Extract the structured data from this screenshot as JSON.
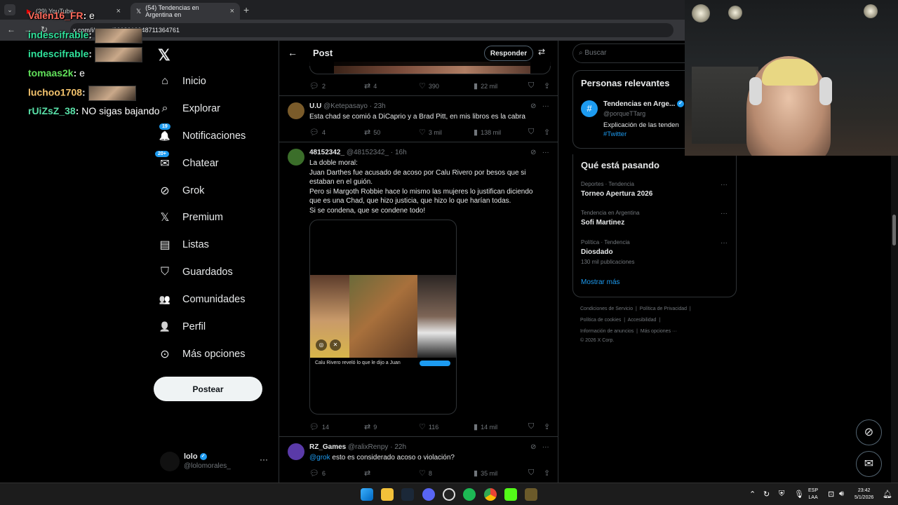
{
  "browser": {
    "tabs": [
      {
        "label": "(29) YouTube"
      },
      {
        "label": "(54) Tendencias en Argentina en"
      }
    ],
    "url": "x.com/i/status/2008010048711364761"
  },
  "chat": [
    {
      "user": "Valen16_FR",
      "color": "#ff6a5b",
      "msg": "e"
    },
    {
      "user": "indescifrable",
      "color": "#2fe09a",
      "msg": ""
    },
    {
      "user": "indescifrable",
      "color": "#2fe09a",
      "msg": ""
    },
    {
      "user": "tomaas2k",
      "color": "#61e05a",
      "msg": "e"
    },
    {
      "user": "luchoo1708",
      "color": "#f2c26c",
      "msg": ""
    },
    {
      "user": "rUiZsZ_38",
      "color": "#59e0a8",
      "msg": "NO sigas bajando"
    }
  ],
  "nav": {
    "items": [
      {
        "label": "Inicio",
        "icon": "⌂"
      },
      {
        "label": "Explorar",
        "icon": "⌕"
      },
      {
        "label": "Notificaciones",
        "icon": "🔔",
        "badge": "19"
      },
      {
        "label": "Chatear",
        "icon": "✉",
        "badge": "20+"
      },
      {
        "label": "Grok",
        "icon": "⊘"
      },
      {
        "label": "Premium",
        "icon": "𝕏"
      },
      {
        "label": "Listas",
        "icon": "▤"
      },
      {
        "label": "Guardados",
        "icon": "⛉"
      },
      {
        "label": "Comunidades",
        "icon": "👥"
      },
      {
        "label": "Perfil",
        "icon": "👤"
      },
      {
        "label": "Más opciones",
        "icon": "⊙"
      }
    ],
    "post_label": "Postear"
  },
  "account": {
    "name": "lolo",
    "handle": "@lolomorales_"
  },
  "header": {
    "title": "Post",
    "reply_label": "Responder"
  },
  "top_actions": {
    "replies": "2",
    "reposts": "4",
    "likes": "390",
    "views": "22 mil"
  },
  "tweets": [
    {
      "name": "U.U",
      "handle": "@Ketepasayo",
      "time": "23h",
      "avatar_color": "#7a5b2a",
      "text": "Esta chad se comió a DiCaprio y a Brad Pitt, en mis libros es la cabra",
      "actions": {
        "replies": "4",
        "reposts": "50",
        "likes": "3 mil",
        "views": "138 mil"
      }
    },
    {
      "name": "48152342_",
      "handle": "@48152342_",
      "time": "16h",
      "avatar_color": "#3b6e2a",
      "lines": [
        "La doble moral:",
        "Juan Darthes fue acusado de acoso por Calu Rivero por besos que si",
        "estaban en el guión.",
        "Pero si Margoth Robbie hace lo mismo las mujeres lo justifican diciendo",
        "que es una Chad, que hizo justicia, que hizo lo que harían todas.",
        "Si se condena, que se condene todo!"
      ],
      "video_caption": "Calu Rivero reveló lo que le dijo a Juan",
      "actions": {
        "replies": "14",
        "reposts": "9",
        "likes": "116",
        "views": "14 mil"
      }
    },
    {
      "name": "RZ_Games",
      "handle": "@ralixRenpy",
      "time": "22h",
      "avatar_color": "#5a3aa8",
      "mention": "@grok",
      "text": " esto es considerado acoso o violación?",
      "actions": {
        "replies": "6",
        "reposts": "",
        "likes": "8",
        "views": "35 mil"
      }
    }
  ],
  "search": {
    "placeholder": "Buscar"
  },
  "relevant": {
    "title": "Personas relevantes",
    "name": "Tendencias en Arge...",
    "handle": "@porqueTTarg",
    "bio": "Explicación de las tenden",
    "hashtag": "#Twitter"
  },
  "trends": {
    "title": "Qué está pasando",
    "items": [
      {
        "category": "Deportes · Tendencia",
        "name": "Torneo Apertura 2026",
        "count": ""
      },
      {
        "category": "Tendencia en Argentina",
        "name": "Sofi Martinez",
        "count": ""
      },
      {
        "category": "Política · Tendencia",
        "name": "Diosdado",
        "count": "130 mil publicaciones"
      }
    ],
    "show_more": "Mostrar más"
  },
  "footer": {
    "line1a": "Condiciones de Servicio",
    "line1b": "Política de Privacidad",
    "line2a": "Política de cookies",
    "line2b": "Accesibilidad",
    "line3a": "Información de anuncios",
    "line3b": "Más opciones ···",
    "line4": "© 2026 X Corp."
  },
  "taskbar": {
    "lang": "ESP",
    "layout": "LAA",
    "time": "23:42",
    "date": "5/1/2026"
  },
  "colors": {
    "accent": "#1d9bf0",
    "background": "#000000",
    "border": "#2f3336",
    "muted": "#71767b"
  }
}
